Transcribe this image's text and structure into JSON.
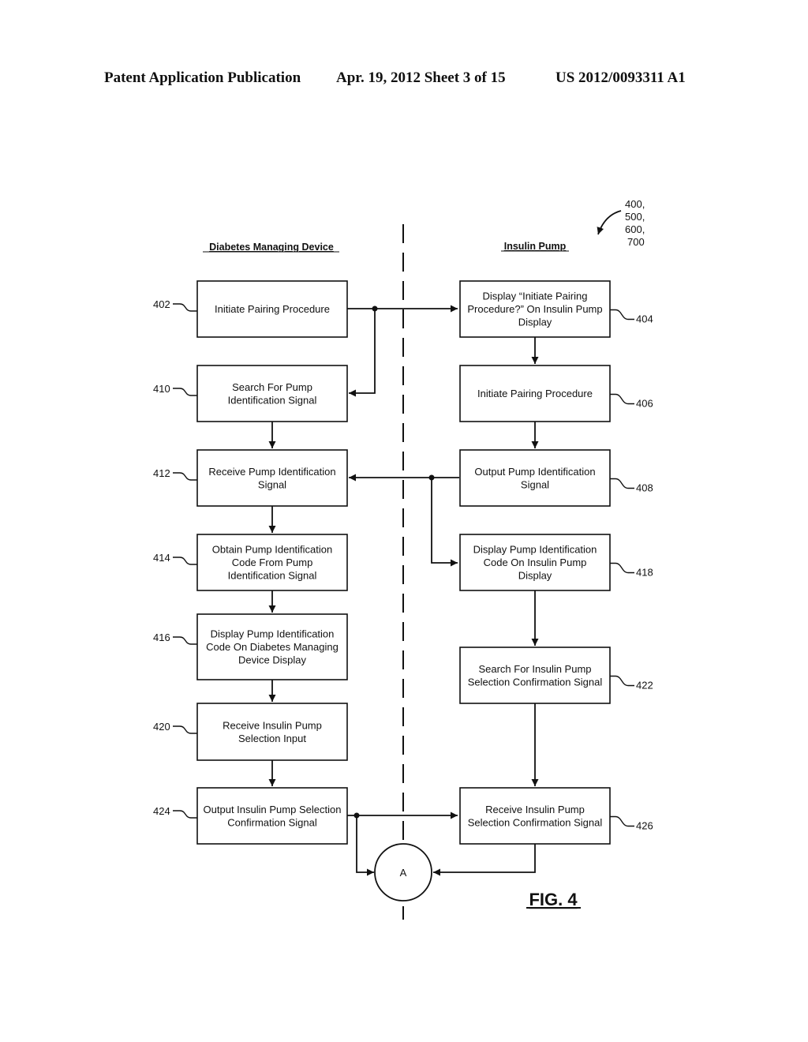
{
  "header": {
    "publication": "Patent Application Publication",
    "date_sheet": "Apr. 19, 2012  Sheet 3 of 15",
    "patent_number": "US 2012/0093311 A1"
  },
  "figure": {
    "label": "FIG. 4",
    "reference_numbers": [
      "400,",
      "500,",
      "600,",
      "700"
    ],
    "lanes": {
      "left": "Diabetes Managing Device",
      "right": "Insulin Pump"
    },
    "connector_label": "A",
    "steps": {
      "s402": {
        "ref": "402",
        "lines": [
          "Initiate Pairing Procedure"
        ]
      },
      "s410": {
        "ref": "410",
        "lines": [
          "Search For Pump",
          "Identification Signal"
        ]
      },
      "s412": {
        "ref": "412",
        "lines": [
          "Receive Pump Identification",
          "Signal"
        ]
      },
      "s414": {
        "ref": "414",
        "lines": [
          "Obtain Pump Identification",
          "Code From Pump",
          "Identification Signal"
        ]
      },
      "s416": {
        "ref": "416",
        "lines": [
          "Display Pump Identification",
          "Code On Diabetes Managing",
          "Device Display"
        ]
      },
      "s420": {
        "ref": "420",
        "lines": [
          "Receive Insulin Pump",
          "Selection Input"
        ]
      },
      "s424": {
        "ref": "424",
        "lines": [
          "Output Insulin Pump Selection",
          "Confirmation Signal"
        ]
      },
      "s404": {
        "ref": "404",
        "lines": [
          "Display “Initiate Pairing",
          "Procedure?” On Insulin Pump",
          "Display"
        ]
      },
      "s406": {
        "ref": "406",
        "lines": [
          "Initiate Pairing Procedure"
        ]
      },
      "s408": {
        "ref": "408",
        "lines": [
          "Output Pump Identification",
          "Signal"
        ]
      },
      "s418": {
        "ref": "418",
        "lines": [
          "Display Pump Identification",
          "Code On Insulin Pump",
          "Display"
        ]
      },
      "s422": {
        "ref": "422",
        "lines": [
          "Search For Insulin Pump",
          "Selection Confirmation Signal"
        ]
      },
      "s426": {
        "ref": "426",
        "lines": [
          "Receive Insulin Pump",
          "Selection Confirmation Signal"
        ]
      }
    }
  }
}
